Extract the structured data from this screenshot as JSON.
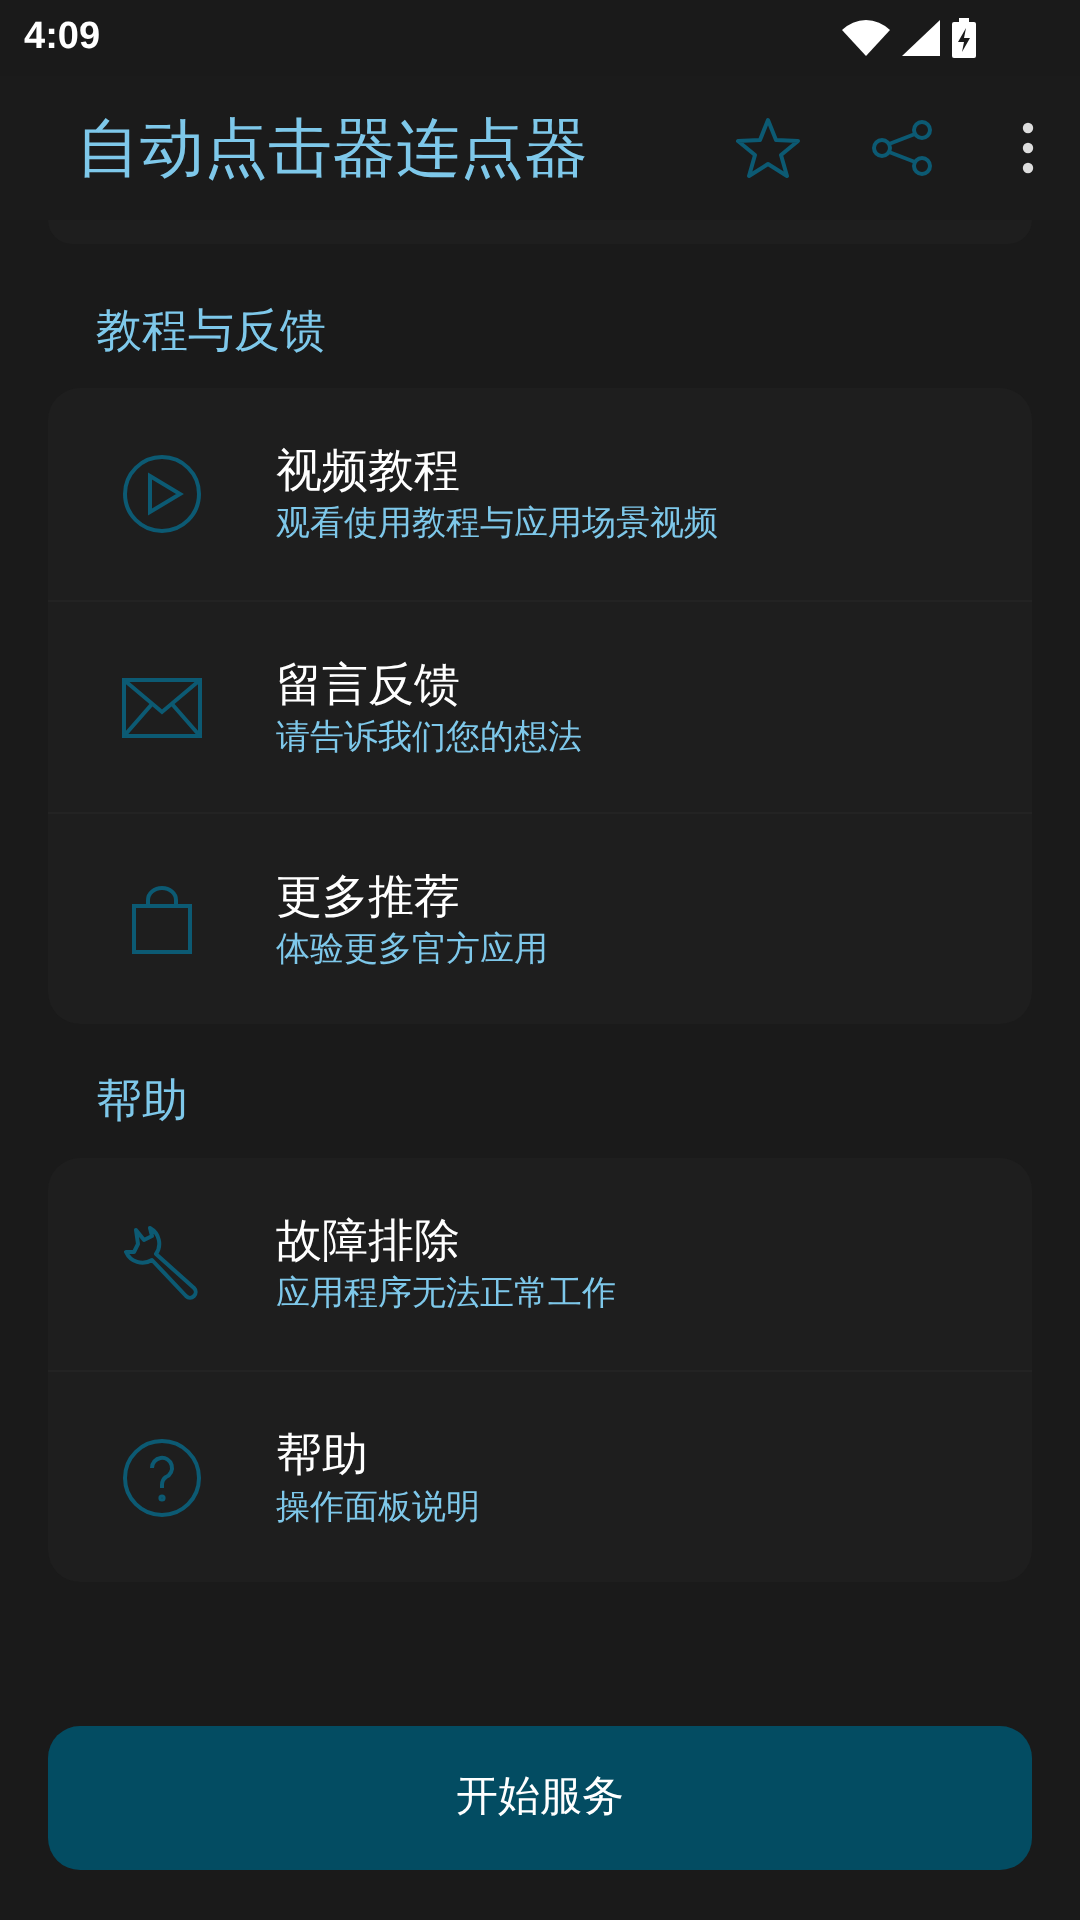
{
  "status_bar": {
    "time": "4:09"
  },
  "app_bar": {
    "title": "自动点击器连点器"
  },
  "sections": [
    {
      "title": "教程与反馈",
      "items": [
        {
          "title": "视频教程",
          "subtitle": "观看使用教程与应用场景视频"
        },
        {
          "title": "留言反馈",
          "subtitle": "请告诉我们您的想法"
        },
        {
          "title": "更多推荐",
          "subtitle": "体验更多官方应用"
        }
      ]
    },
    {
      "title": "帮助",
      "items": [
        {
          "title": "故障排除",
          "subtitle": "应用程序无法正常工作"
        },
        {
          "title": "帮助",
          "subtitle": "操作面板说明"
        }
      ]
    }
  ],
  "primary_button": "开始服务"
}
